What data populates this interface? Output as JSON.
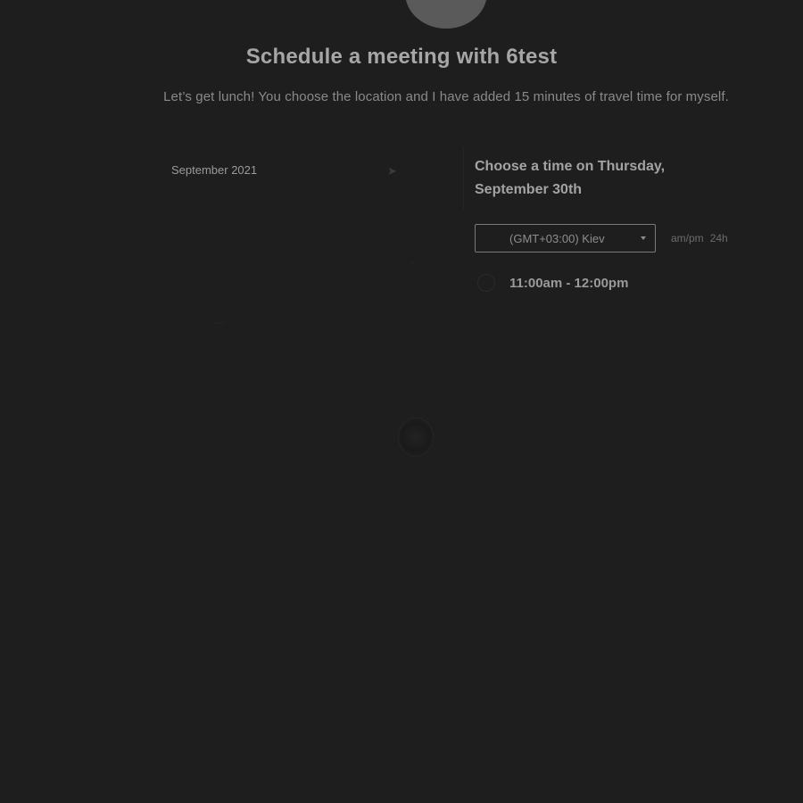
{
  "header": {
    "title": "Schedule a meeting with 6test",
    "description": "Let’s get lunch! You choose the location and I have added 15 minutes of travel time for myself."
  },
  "calendar": {
    "month_label": "September 2021",
    "next_icon": "chevron-right-icon"
  },
  "slots": {
    "heading": "Choose a time on Thursday, September 30th",
    "timezone": "(GMT+03:00) Kiev",
    "format_ampm": "am/pm",
    "format_24h": "24h",
    "items": [
      {
        "label": "11:00am - 12:00pm"
      }
    ]
  }
}
